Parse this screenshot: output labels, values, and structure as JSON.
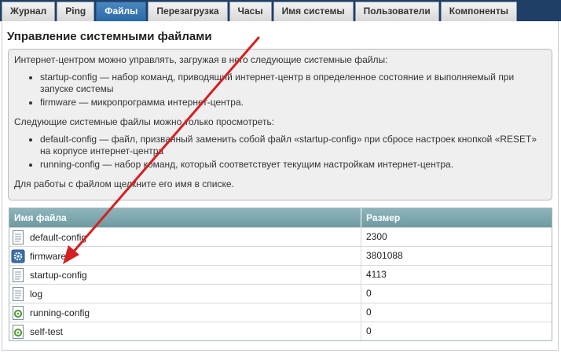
{
  "tabs": [
    {
      "label": "Журнал"
    },
    {
      "label": "Ping"
    },
    {
      "label": "Файлы",
      "active": true
    },
    {
      "label": "Перезагрузка"
    },
    {
      "label": "Часы"
    },
    {
      "label": "Имя системы"
    },
    {
      "label": "Пользователи"
    },
    {
      "label": "Компоненты"
    }
  ],
  "page": {
    "title": "Управление системными файлами"
  },
  "info": {
    "intro": "Интернет-центром можно управлять, загружая в него следующие системные файлы:",
    "editable": [
      "startup-config — набор команд, приводящий интернет-центр в определенное состояние и выполняемый при запуске системы",
      "firmware — микропрограмма интернет-центра."
    ],
    "readonly_intro": "Следующие системные файлы можно только просмотреть:",
    "readonly": [
      "default-config — файл, призванный заменить собой файл «startup-config» при сбросе настроек кнопкой «RESET» на корпусе интернет-центра",
      "running-config — набор команд, который соответствует текущим настройкам интернет-центра."
    ],
    "hint": "Для работы с файлом щелкните его имя в списке."
  },
  "table": {
    "headers": {
      "name": "Имя файла",
      "size": "Размер"
    },
    "rows": [
      {
        "name": "default-config",
        "size": "2300",
        "icon": "document-icon"
      },
      {
        "name": "firmware",
        "size": "3801088",
        "icon": "gear-icon"
      },
      {
        "name": "startup-config",
        "size": "4113",
        "icon": "document-icon"
      },
      {
        "name": "log",
        "size": "0",
        "icon": "document-icon"
      },
      {
        "name": "running-config",
        "size": "0",
        "icon": "document-gear-icon"
      },
      {
        "name": "self-test",
        "size": "0",
        "icon": "document-gear-icon"
      }
    ]
  },
  "colors": {
    "tabbar": "#1f3f66",
    "active_tab": "#2b6aa8",
    "table_header": "#7ea6ad",
    "annotation_arrow": "#d42020"
  }
}
